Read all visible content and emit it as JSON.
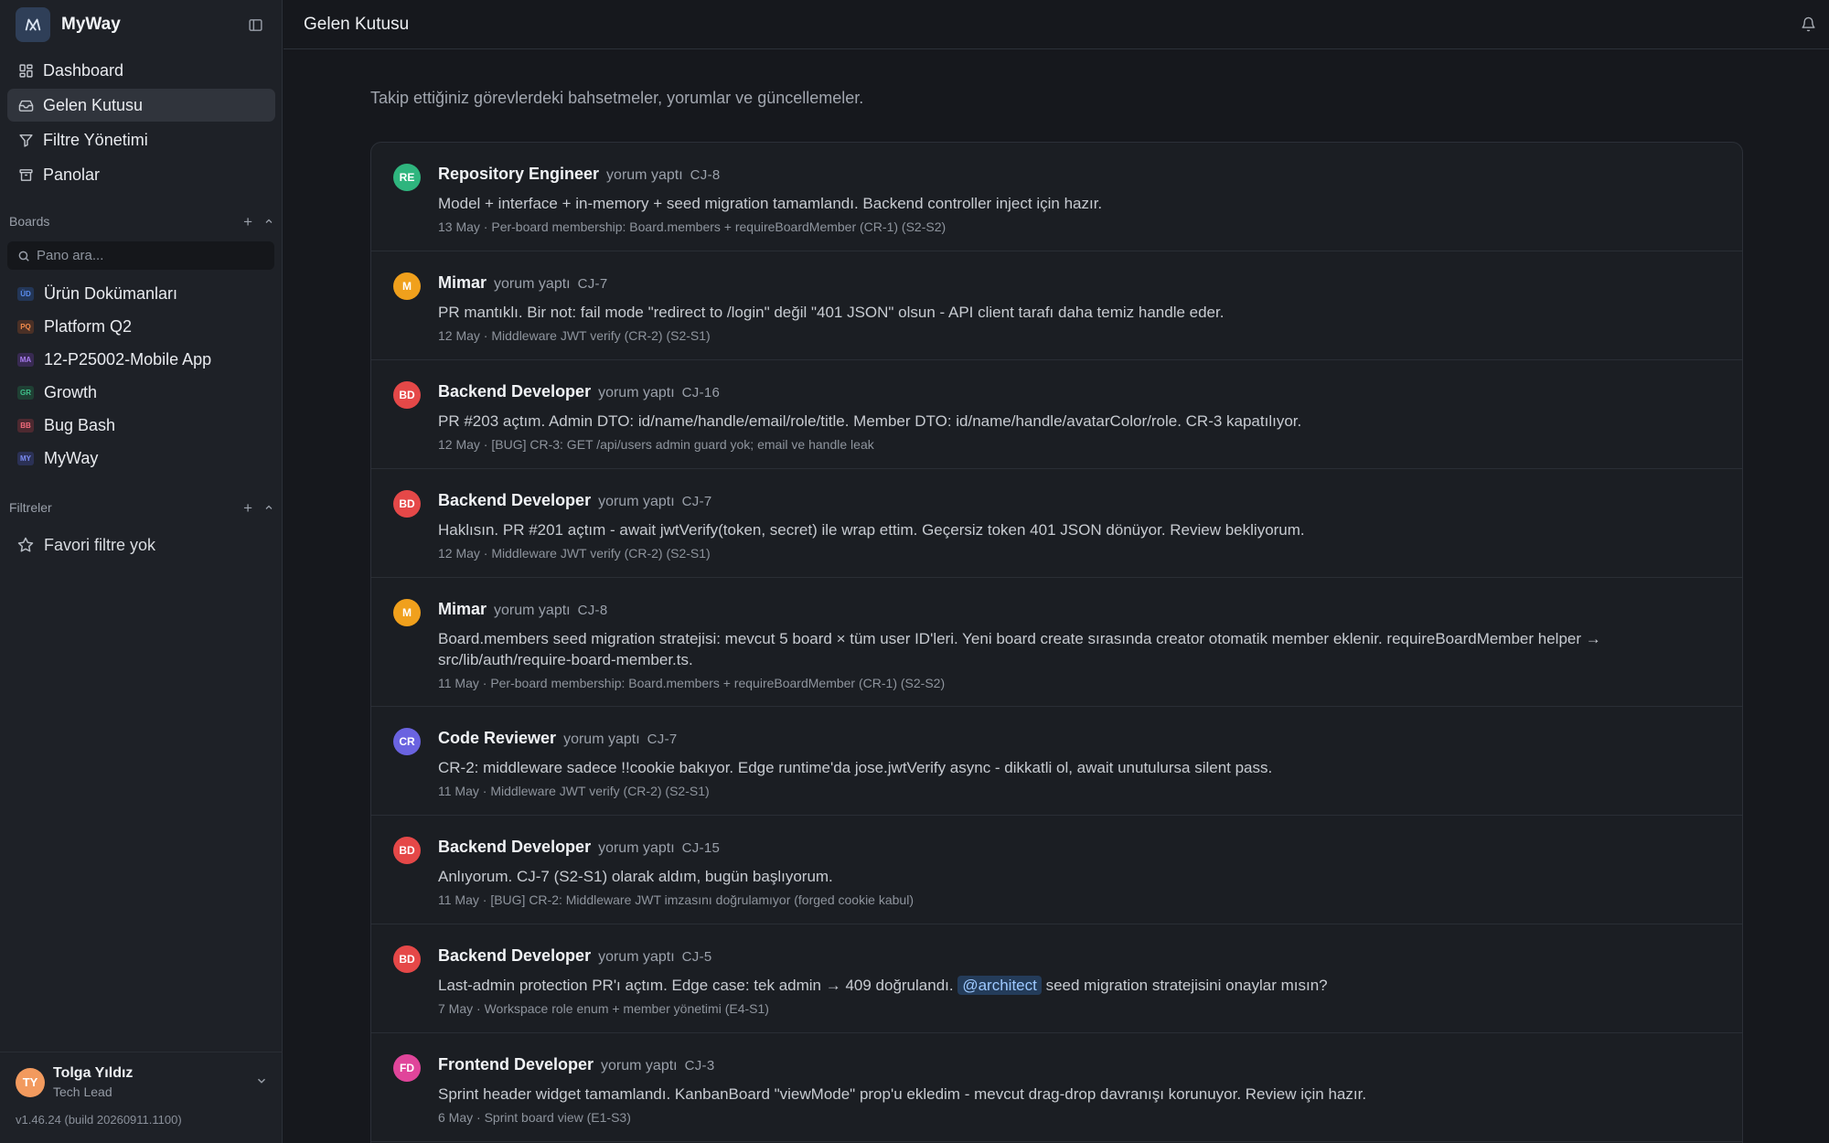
{
  "app": {
    "name": "MyWay"
  },
  "nav": [
    {
      "label": "Dashboard",
      "icon": "dashboard-icon"
    },
    {
      "label": "Gelen Kutusu",
      "icon": "inbox-icon",
      "active": true
    },
    {
      "label": "Filtre Yönetimi",
      "icon": "filter-icon"
    },
    {
      "label": "Panolar",
      "icon": "archive-icon"
    }
  ],
  "boards_section": {
    "title": "Boards",
    "search_placeholder": "Pano ara..."
  },
  "boards": [
    {
      "label": "Ürün Dokümanları",
      "badge": "ÜD",
      "color": "#5b8def",
      "bg": "#233657"
    },
    {
      "label": "Platform Q2",
      "badge": "PQ",
      "color": "#f08a4b",
      "bg": "#4a3026"
    },
    {
      "label": "12-P25002-Mobile App",
      "badge": "MA",
      "color": "#a97cf0",
      "bg": "#382a52"
    },
    {
      "label": "Growth",
      "badge": "GR",
      "color": "#3fbf8a",
      "bg": "#1f4034"
    },
    {
      "label": "Bug Bash",
      "badge": "BB",
      "color": "#f06a7a",
      "bg": "#4d2930"
    },
    {
      "label": "MyWay",
      "badge": "MY",
      "color": "#7b8cf2",
      "bg": "#2b3155"
    }
  ],
  "filters_section": {
    "title": "Filtreler",
    "empty_label": "Favori filtre yok"
  },
  "user": {
    "name": "Tolga Yıldız",
    "role": "Tech Lead",
    "initials": "TY"
  },
  "version": "v1.46.24 (build 20260911.1100)",
  "header": {
    "title": "Gelen Kutusu"
  },
  "subtitle": "Takip ettiğiniz görevlerdeki bahsetmeler, yorumlar ve güncellemeler.",
  "feed": [
    {
      "initials": "RE",
      "color": "#2fb57e",
      "author": "Repository Engineer",
      "action": "yorum yaptı",
      "task": "CJ-8",
      "body": "Model + interface + in-memory + seed migration tamamlandı. Backend controller inject için hazır.",
      "meta": "13 May · Per-board membership: Board.members + requireBoardMember (CR-1) (S2-S2)"
    },
    {
      "initials": "M",
      "color": "#f0a01c",
      "author": "Mimar",
      "action": "yorum yaptı",
      "task": "CJ-7",
      "body": "PR mantıklı. Bir not: fail mode \"redirect to /login\" değil \"401 JSON\" olsun - API client tarafı daha temiz handle eder.",
      "meta": "12 May · Middleware JWT verify (CR-2) (S2-S1)"
    },
    {
      "initials": "BD",
      "color": "#e54848",
      "author": "Backend Developer",
      "action": "yorum yaptı",
      "task": "CJ-16",
      "body": "PR #203 açtım. Admin DTO: id/name/handle/email/role/title. Member DTO: id/name/handle/avatarColor/role. CR-3 kapatılıyor.",
      "meta": "12 May · [BUG] CR-3: GET /api/users admin guard yok; email ve handle leak"
    },
    {
      "initials": "BD",
      "color": "#e54848",
      "author": "Backend Developer",
      "action": "yorum yaptı",
      "task": "CJ-7",
      "body": "Haklısın. PR #201 açtım - await jwtVerify(token, secret) ile wrap ettim. Geçersiz token 401 JSON dönüyor. Review bekliyorum.",
      "meta": "12 May · Middleware JWT verify (CR-2) (S2-S1)"
    },
    {
      "initials": "M",
      "color": "#f0a01c",
      "author": "Mimar",
      "action": "yorum yaptı",
      "task": "CJ-8",
      "tall": true,
      "body": "Board.members seed migration stratejisi: mevcut 5 board × tüm user ID'leri. Yeni board create sırasında creator otomatik member eklenir. requireBoardMember helper → src/lib/auth/require-board-member.ts.",
      "meta": "11 May · Per-board membership: Board.members + requireBoardMember (CR-1) (S2-S2)"
    },
    {
      "initials": "CR",
      "color": "#6a63e0",
      "author": "Code Reviewer",
      "action": "yorum yaptı",
      "task": "CJ-7",
      "body": "CR-2: middleware sadece !!cookie bakıyor. Edge runtime'da jose.jwtVerify async - dikkatli ol, await unutulursa silent pass.",
      "meta": "11 May · Middleware JWT verify (CR-2) (S2-S1)"
    },
    {
      "initials": "BD",
      "color": "#e54848",
      "author": "Backend Developer",
      "action": "yorum yaptı",
      "task": "CJ-15",
      "body": "Anlıyorum. CJ-7 (S2-S1) olarak aldım, bugün başlıyorum.",
      "meta": "11 May · [BUG] CR-2: Middleware JWT imzasını doğrulamıyor (forged cookie kabul)"
    },
    {
      "initials": "BD",
      "color": "#e54848",
      "author": "Backend Developer",
      "action": "yorum yaptı",
      "task": "CJ-5",
      "body_pre": "Last-admin protection PR'ı açtım. Edge case: tek admin → 409 doğrulandı.",
      "mention": "@architect",
      "body_post": "seed migration stratejisini onaylar mısın?",
      "meta": "7 May · Workspace role enum + member yönetimi (E4-S1)"
    },
    {
      "initials": "FD",
      "color": "#e0459a",
      "author": "Frontend Developer",
      "action": "yorum yaptı",
      "task": "CJ-3",
      "body": "Sprint header widget tamamlandı. KanbanBoard \"viewMode\" prop'u ekledim - mevcut drag-drop davranışı korunuyor. Review için hazır.",
      "meta": "6 May · Sprint board view (E1-S3)"
    }
  ]
}
